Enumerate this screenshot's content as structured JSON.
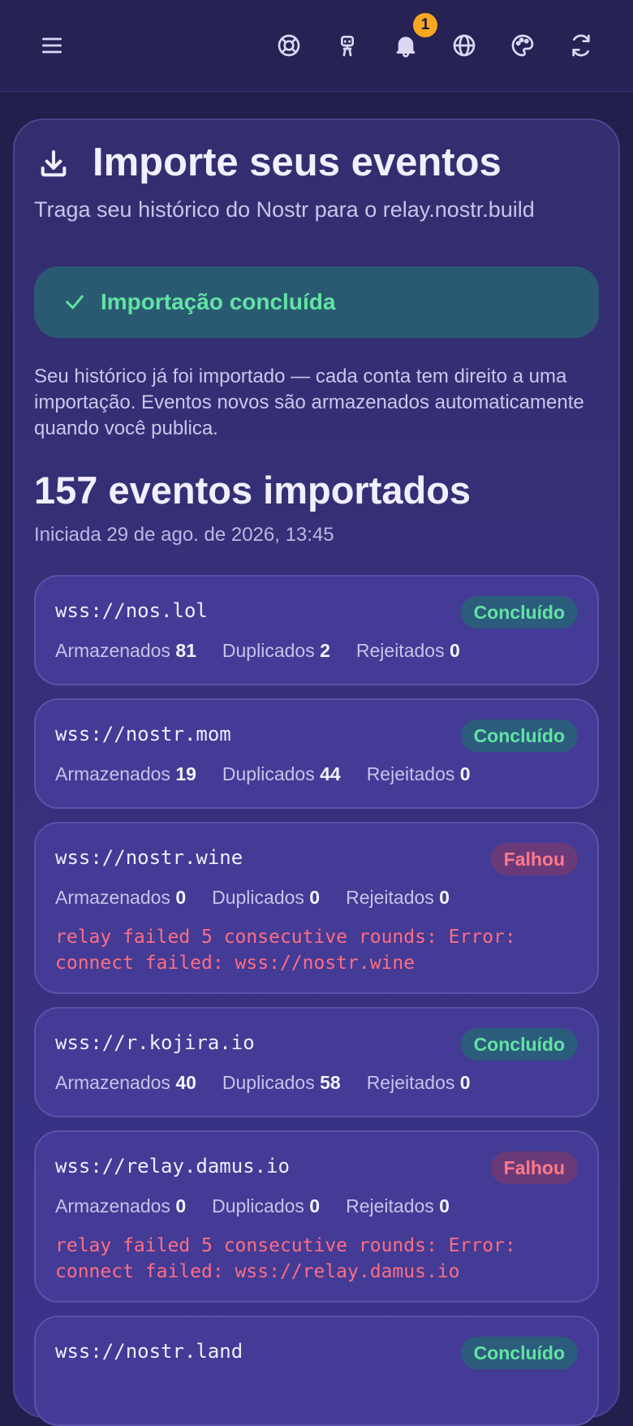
{
  "topbar": {
    "menu_icon": "hamburger-menu-icon",
    "icons": [
      "lifebuoy-icon",
      "robot-icon",
      "bell-icon",
      "globe-icon",
      "palette-icon",
      "refresh-icon"
    ],
    "notification_count": "1"
  },
  "header": {
    "icon": "download-icon",
    "title": "Importe seus eventos",
    "subtitle": "Traga seu histórico do Nostr para o relay.nostr.build"
  },
  "banner": {
    "icon": "check-icon",
    "text": "Importação concluída"
  },
  "info": "Seu histórico já foi importado — cada conta tem direito a uma importação. Eventos novos são armazenados automaticamente quando você publica.",
  "summary": {
    "count_heading": "157 eventos importados",
    "started": "Iniciada 29 de ago. de 2026, 13:45"
  },
  "labels": {
    "stored": "Armazenados",
    "duplicates": "Duplicados",
    "rejected": "Rejeitados"
  },
  "relays": [
    {
      "url": "wss://nos.lol",
      "status": "Concluído",
      "stored": "81",
      "duplicates": "2",
      "rejected": "0",
      "error": ""
    },
    {
      "url": "wss://nostr.mom",
      "status": "Concluído",
      "stored": "19",
      "duplicates": "44",
      "rejected": "0",
      "error": ""
    },
    {
      "url": "wss://nostr.wine",
      "status": "Falhou",
      "stored": "0",
      "duplicates": "0",
      "rejected": "0",
      "error": "relay failed 5 consecutive rounds: Error: connect failed: wss://nostr.wine"
    },
    {
      "url": "wss://r.kojira.io",
      "status": "Concluído",
      "stored": "40",
      "duplicates": "58",
      "rejected": "0",
      "error": ""
    },
    {
      "url": "wss://relay.damus.io",
      "status": "Falhou",
      "stored": "0",
      "duplicates": "0",
      "rejected": "0",
      "error": "relay failed 5 consecutive rounds: Error: connect failed: wss://relay.damus.io"
    },
    {
      "url": "wss://nostr.land",
      "status": "Concluído",
      "stored": "",
      "duplicates": "",
      "rejected": "",
      "error": ""
    }
  ],
  "colors": {
    "background": "#231f4d",
    "success": "#62e3a4",
    "failure": "#ff7a8a",
    "badge": "#f6a823"
  }
}
